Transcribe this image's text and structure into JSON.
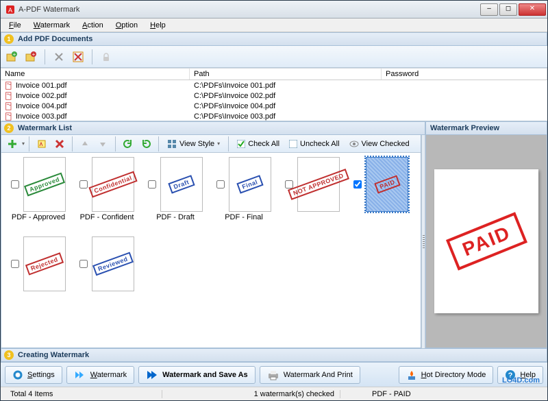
{
  "window": {
    "title": "A-PDF Watermark"
  },
  "menu": {
    "file": "File",
    "watermark": "Watermark",
    "action": "Action",
    "option": "Option",
    "help": "Help"
  },
  "section1": {
    "num": "1",
    "title": "Add PDF Documents"
  },
  "doc_header": {
    "name": "Name",
    "path": "Path",
    "password": "Password"
  },
  "docs": [
    {
      "name": "Invoice 001.pdf",
      "path": "C:\\PDFs\\Invoice 001.pdf"
    },
    {
      "name": "Invoice 002.pdf",
      "path": "C:\\PDFs\\Invoice 002.pdf"
    },
    {
      "name": "Invoice 004.pdf",
      "path": "C:\\PDFs\\Invoice 004.pdf"
    },
    {
      "name": "Invoice 003.pdf",
      "path": "C:\\PDFs\\Invoice 003.pdf"
    }
  ],
  "section2": {
    "num": "2",
    "title": "Watermark List",
    "preview_title": "Watermark Preview"
  },
  "wm_toolbar": {
    "view_style": "View Style",
    "check_all": "Check All",
    "uncheck_all": "Uncheck All",
    "view_checked": "View Checked"
  },
  "watermarks": [
    {
      "label": "PDF - Approved",
      "text": "Approved",
      "color": "#2a8a3a",
      "checked": false,
      "selected": false
    },
    {
      "label": "PDF - Confident",
      "text": "Confidential",
      "color": "#c03030",
      "checked": false,
      "selected": false
    },
    {
      "label": "PDF - Draft",
      "text": "Draft",
      "color": "#2a50b0",
      "checked": false,
      "selected": false
    },
    {
      "label": "PDF - Final",
      "text": "Final",
      "color": "#2a50b0",
      "checked": false,
      "selected": false
    },
    {
      "label": "",
      "text": "NOT APPROVED",
      "color": "#c03030",
      "checked": false,
      "selected": false
    },
    {
      "label": "",
      "text": "PAID",
      "color": "#c03030",
      "checked": true,
      "selected": true
    },
    {
      "label": "",
      "text": "Rejected",
      "color": "#c03030",
      "checked": false,
      "selected": false
    },
    {
      "label": "",
      "text": "Reviewed",
      "color": "#2a50b0",
      "checked": false,
      "selected": false
    }
  ],
  "preview": {
    "text": "PAID"
  },
  "section3": {
    "num": "3",
    "title": "Creating Watermark"
  },
  "actions": {
    "settings": "Settings",
    "watermark": "Watermark",
    "watermark_save_as": "Watermark and Save As",
    "watermark_print": "Watermark And Print",
    "hot_dir": "Hot Directory Mode",
    "help": "Help"
  },
  "status": {
    "total": "Total 4 Items",
    "checked": "1 watermark(s) checked",
    "current": "PDF - PAID"
  },
  "credit": "LO4D.com"
}
